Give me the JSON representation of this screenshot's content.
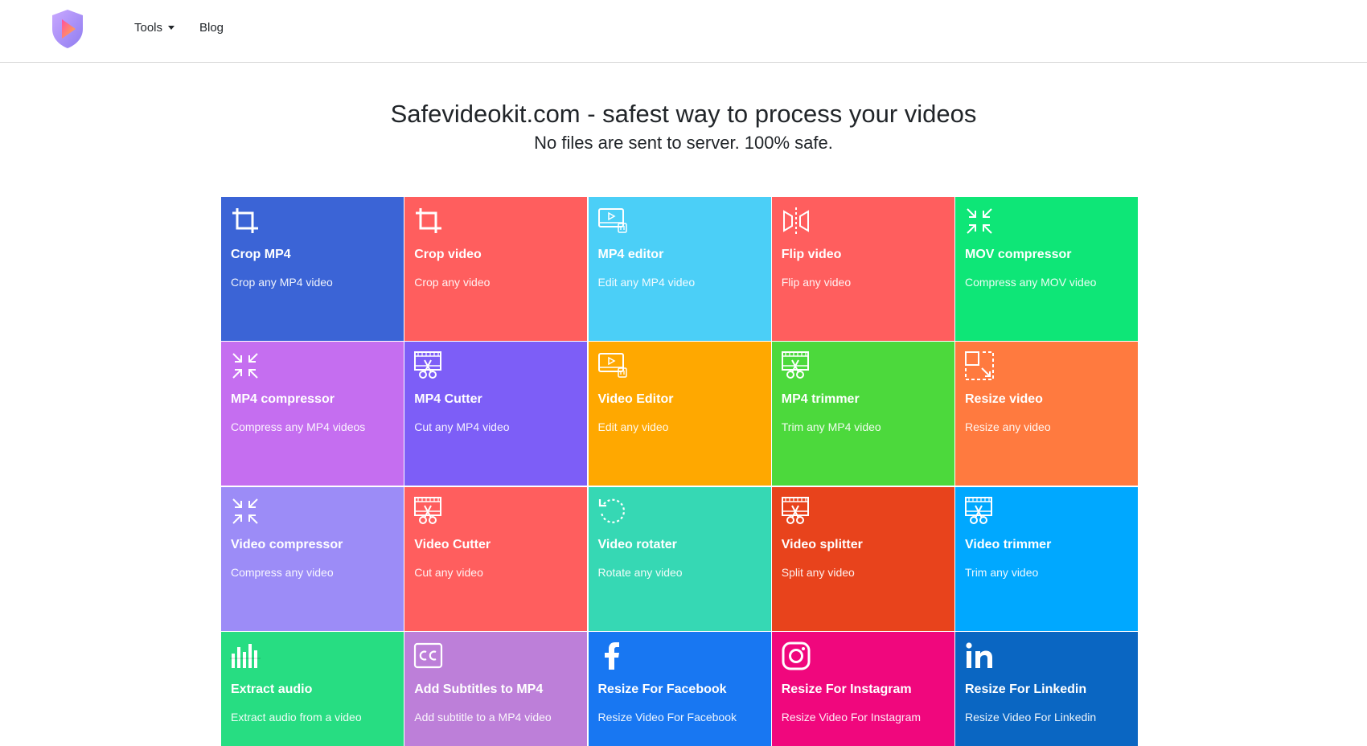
{
  "nav": {
    "tools_label": "Tools",
    "blog_label": "Blog"
  },
  "hero": {
    "title": "Safevideokit.com - safest way to process your videos",
    "subtitle": "No files are sent to server. 100% safe."
  },
  "tiles": [
    {
      "title": "Crop MP4",
      "desc": "Crop any MP4 video",
      "color": "#3b64d6",
      "icon": "crop-icon"
    },
    {
      "title": "Crop video",
      "desc": "Crop any video",
      "color": "#ff5e5e",
      "icon": "crop-icon"
    },
    {
      "title": "MP4 editor",
      "desc": "Edit any MP4 video",
      "color": "#4bcff7",
      "icon": "video-editor-icon"
    },
    {
      "title": "Flip video",
      "desc": "Flip any video",
      "color": "#ff5e5e",
      "icon": "flip-icon"
    },
    {
      "title": "MOV compressor",
      "desc": "Compress any MOV video",
      "color": "#0ee677",
      "icon": "compress-icon"
    },
    {
      "title": "MP4 compressor",
      "desc": "Compress any MP4 videos",
      "color": "#c56ef0",
      "icon": "compress-icon"
    },
    {
      "title": "MP4 Cutter",
      "desc": "Cut any MP4 video",
      "color": "#7d5ef7",
      "icon": "film-cut-icon"
    },
    {
      "title": "Video Editor",
      "desc": "Edit any video",
      "color": "#ffa800",
      "icon": "video-editor-icon"
    },
    {
      "title": "MP4 trimmer",
      "desc": "Trim any MP4 video",
      "color": "#4cd93c",
      "icon": "film-cut-icon"
    },
    {
      "title": "Resize video",
      "desc": "Resize any video",
      "color": "#ff7a3f",
      "icon": "resize-icon"
    },
    {
      "title": "Video compressor",
      "desc": "Compress any video",
      "color": "#9c8cf7",
      "icon": "compress-icon"
    },
    {
      "title": "Video Cutter",
      "desc": "Cut any video",
      "color": "#ff5e5e",
      "icon": "film-cut-icon"
    },
    {
      "title": "Video rotater",
      "desc": "Rotate any video",
      "color": "#36d8b4",
      "icon": "rotate-icon"
    },
    {
      "title": "Video splitter",
      "desc": "Split any video",
      "color": "#e8431c",
      "icon": "film-cut-icon"
    },
    {
      "title": "Video trimmer",
      "desc": "Trim any video",
      "color": "#00a8ff",
      "icon": "film-cut-icon"
    },
    {
      "title": "Extract audio",
      "desc": "Extract audio from a video",
      "color": "#27dd82",
      "icon": "audio-bars-icon"
    },
    {
      "title": "Add Subtitles to MP4",
      "desc": "Add subtitle to a MP4 video",
      "color": "#bd7fd9",
      "icon": "cc-icon"
    },
    {
      "title": "Resize For Facebook",
      "desc": "Resize Video For Facebook",
      "color": "#1877f2",
      "icon": "facebook-icon"
    },
    {
      "title": "Resize For Instagram",
      "desc": "Resize Video For Instagram",
      "color": "#f0077d",
      "icon": "instagram-icon"
    },
    {
      "title": "Resize For Linkedin",
      "desc": "Resize Video For Linkedin",
      "color": "#0a66c2",
      "icon": "linkedin-icon"
    }
  ]
}
